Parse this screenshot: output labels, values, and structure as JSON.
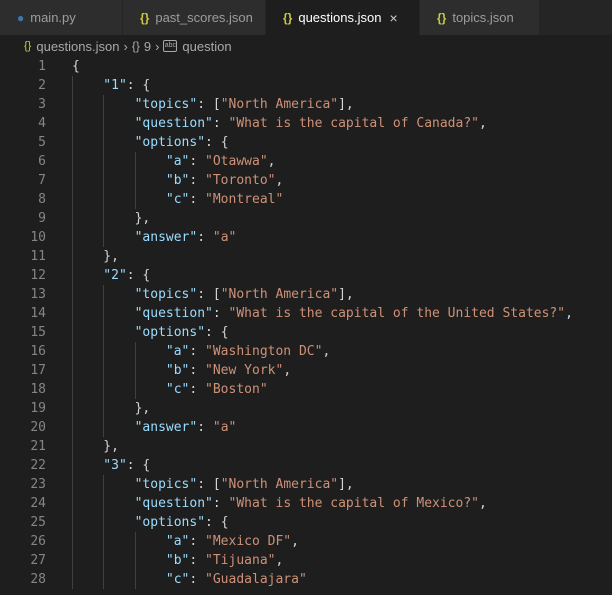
{
  "tabs": [
    {
      "label": "main.py",
      "icon": "python-icon",
      "active": false
    },
    {
      "label": "past_scores.json",
      "icon": "json-icon",
      "active": false
    },
    {
      "label": "questions.json",
      "icon": "json-icon",
      "active": true
    },
    {
      "label": "topics.json",
      "icon": "json-icon",
      "active": false
    }
  ],
  "tab_icon_glyph": "{}",
  "close_glyph": "×",
  "breadcrumb": {
    "file": "questions.json",
    "object_icon": "{}",
    "object": "9",
    "property_icon": "abc",
    "property": "question"
  },
  "colors": {
    "key": "#9cdcfe",
    "string": "#ce9178",
    "punct": "#d4d4d4",
    "json_icon": "#cbcb41"
  },
  "lines": [
    {
      "n": "1",
      "indent": 0,
      "t": [
        [
          "p",
          "{"
        ]
      ]
    },
    {
      "n": "2",
      "indent": 1,
      "t": [
        [
          "k",
          "\"1\""
        ],
        [
          "p",
          ": {"
        ]
      ]
    },
    {
      "n": "3",
      "indent": 2,
      "t": [
        [
          "k",
          "\"topics\""
        ],
        [
          "p",
          ": ["
        ],
        [
          "s",
          "\"North America\""
        ],
        [
          "p",
          "],"
        ]
      ]
    },
    {
      "n": "4",
      "indent": 2,
      "t": [
        [
          "k",
          "\"question\""
        ],
        [
          "p",
          ": "
        ],
        [
          "s",
          "\"What is the capital of Canada?\""
        ],
        [
          "p",
          ","
        ]
      ]
    },
    {
      "n": "5",
      "indent": 2,
      "t": [
        [
          "k",
          "\"options\""
        ],
        [
          "p",
          ": {"
        ]
      ]
    },
    {
      "n": "6",
      "indent": 3,
      "t": [
        [
          "k",
          "\"a\""
        ],
        [
          "p",
          ": "
        ],
        [
          "s",
          "\"Otawwa\""
        ],
        [
          "p",
          ","
        ]
      ]
    },
    {
      "n": "7",
      "indent": 3,
      "t": [
        [
          "k",
          "\"b\""
        ],
        [
          "p",
          ": "
        ],
        [
          "s",
          "\"Toronto\""
        ],
        [
          "p",
          ","
        ]
      ]
    },
    {
      "n": "8",
      "indent": 3,
      "t": [
        [
          "k",
          "\"c\""
        ],
        [
          "p",
          ": "
        ],
        [
          "s",
          "\"Montreal\""
        ]
      ]
    },
    {
      "n": "9",
      "indent": 2,
      "t": [
        [
          "p",
          "},"
        ]
      ]
    },
    {
      "n": "10",
      "indent": 2,
      "t": [
        [
          "k",
          "\"answer\""
        ],
        [
          "p",
          ": "
        ],
        [
          "s",
          "\"a\""
        ]
      ]
    },
    {
      "n": "11",
      "indent": 1,
      "t": [
        [
          "p",
          "},"
        ]
      ]
    },
    {
      "n": "12",
      "indent": 1,
      "t": [
        [
          "k",
          "\"2\""
        ],
        [
          "p",
          ": {"
        ]
      ]
    },
    {
      "n": "13",
      "indent": 2,
      "t": [
        [
          "k",
          "\"topics\""
        ],
        [
          "p",
          ": ["
        ],
        [
          "s",
          "\"North America\""
        ],
        [
          "p",
          "],"
        ]
      ]
    },
    {
      "n": "14",
      "indent": 2,
      "t": [
        [
          "k",
          "\"question\""
        ],
        [
          "p",
          ": "
        ],
        [
          "s",
          "\"What is the capital of the United States?\""
        ],
        [
          "p",
          ","
        ]
      ]
    },
    {
      "n": "15",
      "indent": 2,
      "t": [
        [
          "k",
          "\"options\""
        ],
        [
          "p",
          ": {"
        ]
      ]
    },
    {
      "n": "16",
      "indent": 3,
      "t": [
        [
          "k",
          "\"a\""
        ],
        [
          "p",
          ": "
        ],
        [
          "s",
          "\"Washington DC\""
        ],
        [
          "p",
          ","
        ]
      ]
    },
    {
      "n": "17",
      "indent": 3,
      "t": [
        [
          "k",
          "\"b\""
        ],
        [
          "p",
          ": "
        ],
        [
          "s",
          "\"New York\""
        ],
        [
          "p",
          ","
        ]
      ]
    },
    {
      "n": "18",
      "indent": 3,
      "t": [
        [
          "k",
          "\"c\""
        ],
        [
          "p",
          ": "
        ],
        [
          "s",
          "\"Boston\""
        ]
      ]
    },
    {
      "n": "19",
      "indent": 2,
      "t": [
        [
          "p",
          "},"
        ]
      ]
    },
    {
      "n": "20",
      "indent": 2,
      "t": [
        [
          "k",
          "\"answer\""
        ],
        [
          "p",
          ": "
        ],
        [
          "s",
          "\"a\""
        ]
      ]
    },
    {
      "n": "21",
      "indent": 1,
      "t": [
        [
          "p",
          "},"
        ]
      ]
    },
    {
      "n": "22",
      "indent": 1,
      "t": [
        [
          "k",
          "\"3\""
        ],
        [
          "p",
          ": {"
        ]
      ]
    },
    {
      "n": "23",
      "indent": 2,
      "t": [
        [
          "k",
          "\"topics\""
        ],
        [
          "p",
          ": ["
        ],
        [
          "s",
          "\"North America\""
        ],
        [
          "p",
          "],"
        ]
      ]
    },
    {
      "n": "24",
      "indent": 2,
      "t": [
        [
          "k",
          "\"question\""
        ],
        [
          "p",
          ": "
        ],
        [
          "s",
          "\"What is the capital of Mexico?\""
        ],
        [
          "p",
          ","
        ]
      ]
    },
    {
      "n": "25",
      "indent": 2,
      "t": [
        [
          "k",
          "\"options\""
        ],
        [
          "p",
          ": {"
        ]
      ]
    },
    {
      "n": "26",
      "indent": 3,
      "t": [
        [
          "k",
          "\"a\""
        ],
        [
          "p",
          ": "
        ],
        [
          "s",
          "\"Mexico DF\""
        ],
        [
          "p",
          ","
        ]
      ]
    },
    {
      "n": "27",
      "indent": 3,
      "t": [
        [
          "k",
          "\"b\""
        ],
        [
          "p",
          ": "
        ],
        [
          "s",
          "\"Tijuana\""
        ],
        [
          "p",
          ","
        ]
      ]
    },
    {
      "n": "28",
      "indent": 3,
      "t": [
        [
          "k",
          "\"c\""
        ],
        [
          "p",
          ": "
        ],
        [
          "s",
          "\"Guadalajara\""
        ]
      ]
    }
  ]
}
